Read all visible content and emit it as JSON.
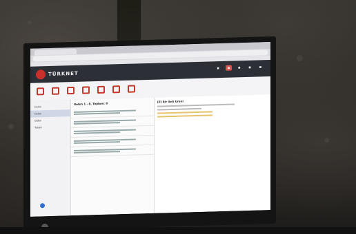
{
  "photo": {
    "subject": "monitor-showing-webmail",
    "screen_app": {
      "logo_text": "TÜRKNET",
      "folders": [
        "Gelen",
        "Gelen",
        "Giden",
        "Taslak"
      ],
      "list_header": "Gelen 1 - 8, Toplam: 8",
      "preview_title": "[E] Bir ileti Ureni"
    }
  },
  "colors": {
    "accent": "#c9302c",
    "appbar": "#2c2f36",
    "wall": "#2a2622"
  }
}
